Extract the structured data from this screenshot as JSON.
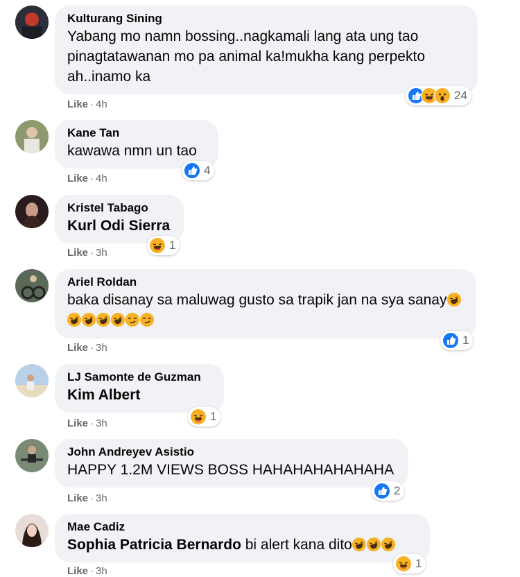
{
  "comments": [
    {
      "author": "Kulturang Sining",
      "text": "Yabang mo namn bossing..nagkamali lang ata ung tao pinagtatawanan mo pa animal ka!mukha kang perpekto ah..inamo ka",
      "like": "Like",
      "time": "4h",
      "reaction_count": "24",
      "avatar_color": "#2c2f3a"
    },
    {
      "author": "Kane Tan",
      "text": "kawawa nmn un tao",
      "like": "Like",
      "time": "4h",
      "reaction_count": "4",
      "avatar_color": "#7d8a62"
    },
    {
      "author": "Kristel Tabago",
      "tag": "Kurl Odi Sierra",
      "like": "Like",
      "time": "3h",
      "reaction_count": "1",
      "avatar_color": "#3a2a2a"
    },
    {
      "author": "Ariel Roldan",
      "text": "baka disanay sa maluwag gusto sa trapik jan na sya sanay",
      "like": "Like",
      "time": "3h",
      "reaction_count": "1",
      "avatar_color": "#4a5a48"
    },
    {
      "author": "LJ Samonte de Guzman",
      "tag": "Kim Albert",
      "like": "Like",
      "time": "3h",
      "reaction_count": "1",
      "avatar_color": "#9ab8d8"
    },
    {
      "author": "John Andreyev Asistio",
      "text": "HAPPY 1.2M VIEWS BOSS HAHAHAHAHAHAHA",
      "like": "Like",
      "time": "3h",
      "reaction_count": "2",
      "avatar_color": "#6c7a66"
    },
    {
      "author": "Mae Cadiz",
      "tag": "Sophia Patricia Bernardo",
      "text": "bi alert kana dito",
      "like": "Like",
      "time": "3h",
      "reaction_count": "1",
      "avatar_color": "#d9c8c4"
    }
  ],
  "icons": {
    "like": "like-reaction-icon",
    "haha": "haha-reaction-icon",
    "wow": "wow-reaction-icon",
    "emoji_rofl": "rolling-laughing-emoji",
    "emoji_smirk": "smirk-emoji"
  },
  "colors": {
    "bubble": "#f0f2f5",
    "meta": "#65676b",
    "like_blue": "#1877f2",
    "emoji_yellow": "#f7b125"
  }
}
